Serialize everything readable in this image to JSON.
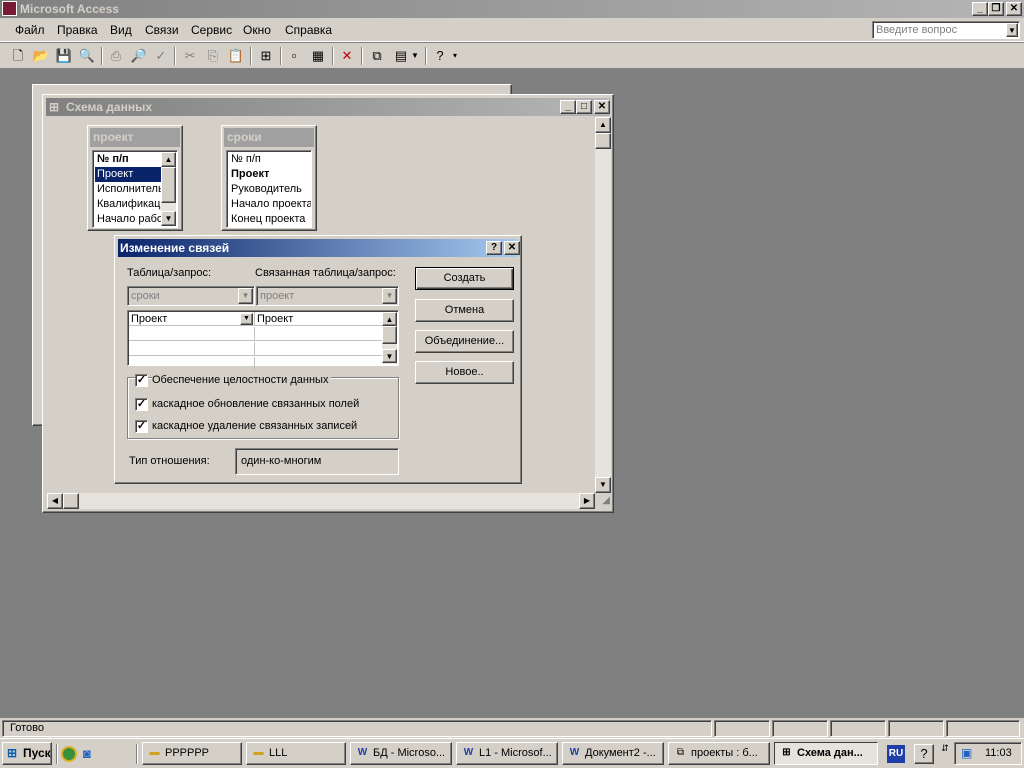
{
  "app": {
    "title": "Microsoft Access"
  },
  "menu": {
    "items": [
      "Файл",
      "Правка",
      "Вид",
      "Связи",
      "Сервис",
      "Окно",
      "Справка"
    ],
    "help_placeholder": "Введите вопрос"
  },
  "schema_window": {
    "title": "Схема данных",
    "tables": [
      {
        "name": "проект",
        "fields": [
          "№ п/п",
          "Проект",
          "Исполнитель",
          "Квалификация",
          "Начало работ"
        ]
      },
      {
        "name": "сроки",
        "fields": [
          "№ п/п",
          "Проект",
          "Руководитель",
          "Начало проекта",
          "Конец проекта"
        ]
      }
    ]
  },
  "dialog": {
    "title": "Изменение связей",
    "help_button": "?",
    "table_label": "Таблица/запрос:",
    "related_label": "Связанная таблица/запрос:",
    "table_value": "сроки",
    "related_value": "проект",
    "field_left": "Проект",
    "field_right": "Проект",
    "buttons": {
      "create": "Создать",
      "cancel": "Отмена",
      "join": "Объединение...",
      "new": "Новое.."
    },
    "integrity_label": "Обеспечение целостности данных",
    "cascade_update_label": "каскадное обновление связанных полей",
    "cascade_delete_label": "каскадное удаление связанных записей",
    "relation_type_label": "Тип отношения:",
    "relation_type_value": "один-ко-многим"
  },
  "statusbar": {
    "text": "Готово"
  },
  "taskbar": {
    "start": "Пуск",
    "tasks": [
      "PPPPPP",
      "LLL",
      "БД - Microso...",
      "L1 - Microsof...",
      "Документ2 -...",
      "проекты : б...",
      "Схема дан..."
    ],
    "language": "RU",
    "clock": "11:03"
  }
}
